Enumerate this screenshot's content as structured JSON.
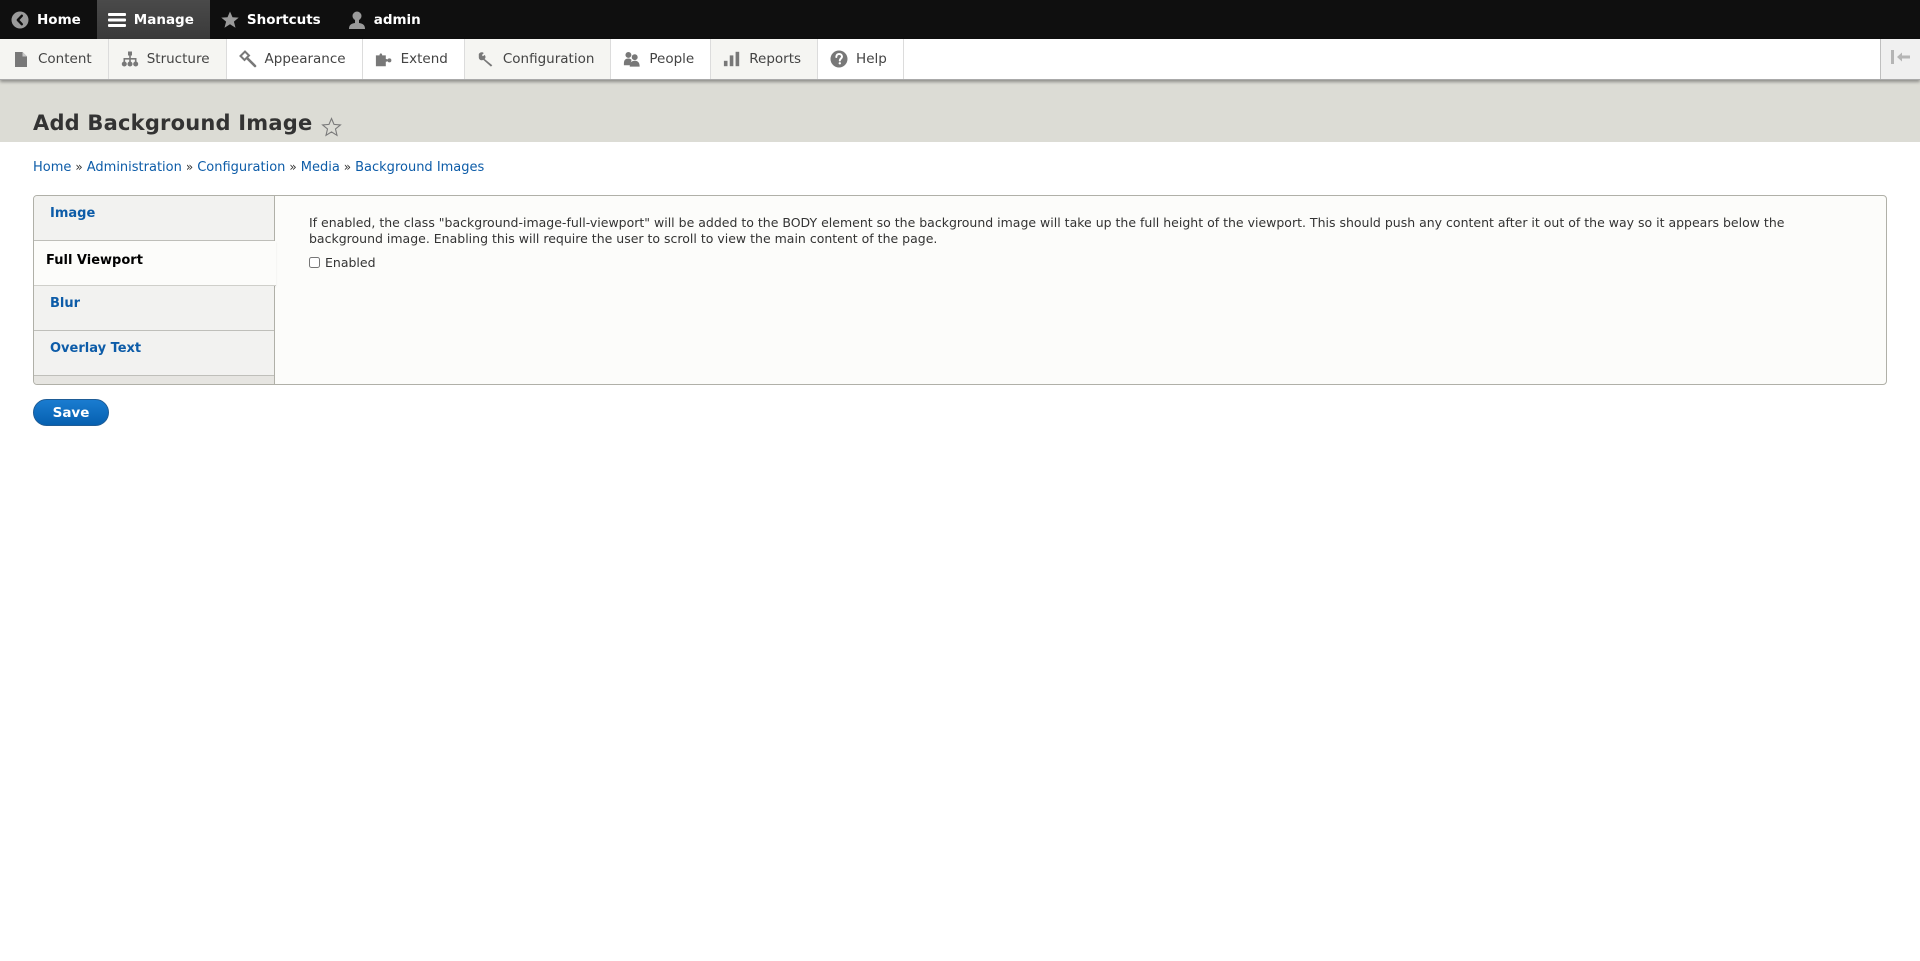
{
  "topbar": {
    "items": [
      {
        "label": "Home",
        "icon": "back-circle-icon"
      },
      {
        "label": "Manage",
        "icon": "hamburger-icon",
        "active": true
      },
      {
        "label": "Shortcuts",
        "icon": "star-icon"
      },
      {
        "label": "admin",
        "icon": "user-icon"
      }
    ]
  },
  "tray": {
    "items": [
      {
        "label": "Content",
        "icon": "file-icon"
      },
      {
        "label": "Structure",
        "icon": "sitemap-icon"
      },
      {
        "label": "Appearance",
        "icon": "paintbrush-icon"
      },
      {
        "label": "Extend",
        "icon": "puzzle-icon"
      },
      {
        "label": "Configuration",
        "icon": "wrench-icon"
      },
      {
        "label": "People",
        "icon": "people-icon"
      },
      {
        "label": "Reports",
        "icon": "bar-chart-icon"
      },
      {
        "label": "Help",
        "icon": "help-icon"
      }
    ],
    "collapse_icon": "collapse-tray-icon"
  },
  "page": {
    "title": "Add Background Image",
    "breadcrumb": [
      "Home",
      "Administration",
      "Configuration",
      "Media",
      "Background Images"
    ],
    "breadcrumb_separator": "»"
  },
  "vertical_tabs": {
    "tabs": [
      "Image",
      "Full Viewport",
      "Blur",
      "Overlay Text"
    ],
    "selected": "Full Viewport",
    "panel": {
      "description": "If enabled, the class \"background-image-full-viewport\" will be added to the BODY element so the background image will take up the full height of the viewport. This should push any content after it out of the way so it appears below the background image. Enabling this will require the user to scroll to view the main content of the page.",
      "checkbox_label": "Enabled",
      "checkbox_checked": false
    }
  },
  "actions": {
    "save_label": "Save"
  },
  "colors": {
    "link": "#0d5ca8",
    "primary_button": "#0b6bc2",
    "topbar_bg": "#0f0f0f",
    "page_header_bg": "#dcdcd5"
  }
}
